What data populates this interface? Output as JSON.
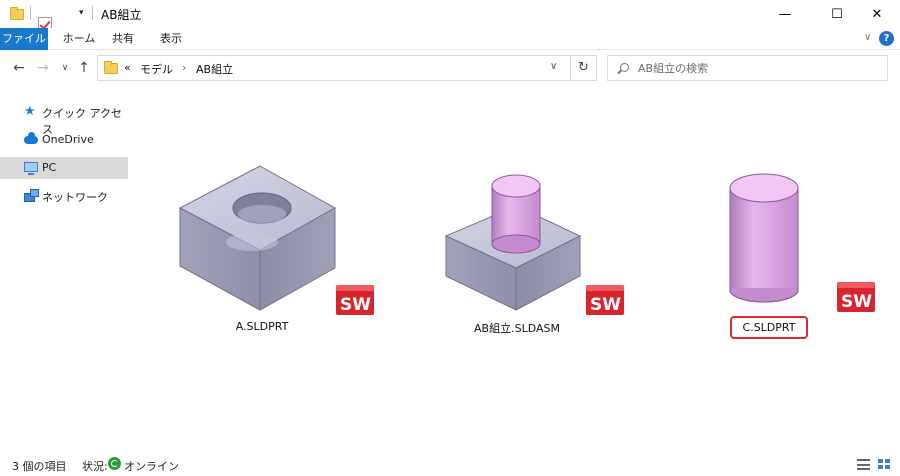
{
  "window": {
    "title": "AB組立",
    "minimize_glyph": "—",
    "maximize_glyph": "☐",
    "close_glyph": "✕"
  },
  "ribbon": {
    "tabs": [
      {
        "label": "ファイル"
      },
      {
        "label": "ホーム"
      },
      {
        "label": "共有"
      },
      {
        "label": "表示"
      }
    ],
    "help_glyph": "?"
  },
  "address_bar": {
    "overflow": "«",
    "path": [
      "モデル",
      "AB組立"
    ],
    "separator": "›"
  },
  "search": {
    "placeholder": "AB組立の検索"
  },
  "sidebar": {
    "items": [
      {
        "label": "クイック アクセス",
        "icon": "star-icon"
      },
      {
        "label": "OneDrive",
        "icon": "cloud-icon"
      },
      {
        "label": "PC",
        "icon": "pc-icon",
        "selected": true
      },
      {
        "label": "ネットワーク",
        "icon": "network-icon"
      }
    ]
  },
  "files": [
    {
      "name": "A.SLDPRT",
      "thumbnail": "block-with-hole",
      "badge": "SW"
    },
    {
      "name": "AB組立.SLDASM",
      "thumbnail": "block-with-cylinder",
      "badge": "SW"
    },
    {
      "name": "C.SLDPRT",
      "thumbnail": "cylinder",
      "badge": "SW",
      "highlighted": true
    }
  ],
  "status": {
    "item_count": "3 個の項目",
    "state_label": "状況:",
    "state_value": "オンライン"
  },
  "colors": {
    "accent": "#1979ca",
    "highlight_border": "#e0262f",
    "solidworks_red": "#d8242c",
    "part_gray": "#a9acc2",
    "part_pink": "#e2a8e8"
  }
}
